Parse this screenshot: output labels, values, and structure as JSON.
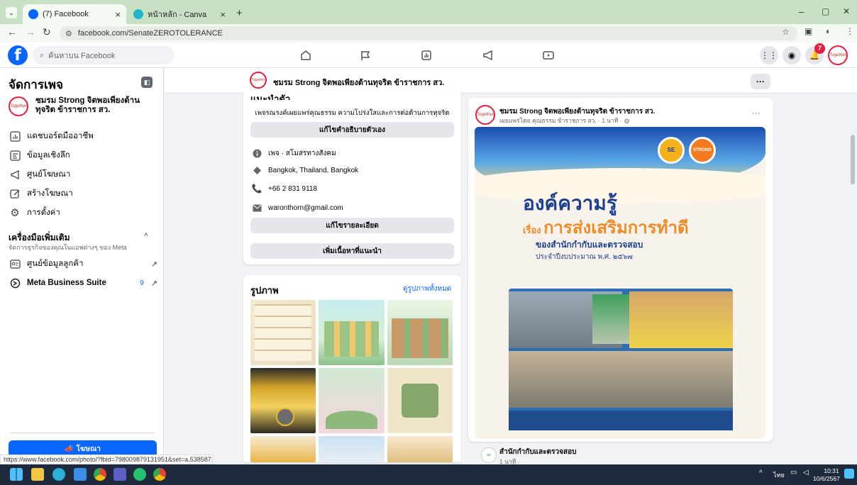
{
  "browser": {
    "tabs": [
      {
        "title": "(7) Facebook",
        "active": true
      },
      {
        "title": "หน้าหลัก - Canva",
        "active": false
      }
    ],
    "new_tab": "+",
    "url": "facebook.com/SenateZEROTOLERANCE",
    "window_controls": [
      "–",
      "▢",
      "✕"
    ]
  },
  "fb_nav": {
    "search_placeholder": "ค้นหาบน Facebook",
    "notif_count": "7"
  },
  "sidebar": {
    "title": "จัดการเพจ",
    "page_name": "ชมรม Strong จิตพอเพียงต้านทุจริต ข้าราชการ สว.",
    "items": [
      {
        "label": "แดชบอร์ดมืออาชีพ",
        "icon": "dashboard-icon"
      },
      {
        "label": "ข้อมูลเชิงลึก",
        "icon": "insights-icon"
      },
      {
        "label": "ศูนย์โฆษณา",
        "icon": "megaphone-icon"
      },
      {
        "label": "สร้างโฆษณา",
        "icon": "edit-icon"
      },
      {
        "label": "การตั้งค่า",
        "icon": "gear-icon"
      }
    ],
    "more_tools_title": "เครื่องมือเพิ่มเติม",
    "more_tools_sub": "จัดการธุรกิจของคุณในแอพต่างๆ ของ Meta",
    "tools": [
      {
        "label": "ศูนย์ข้อมูลลูกค้า",
        "badge": ""
      },
      {
        "label": "Meta Business Suite",
        "badge": "9"
      }
    ],
    "promote_button": "โฆษณา"
  },
  "page_header": {
    "name": "ชมรม Strong จิตพอเพียงต้านทุจริต ข้าราชการ สว.",
    "more": "···"
  },
  "intro": {
    "title": "แนะนำตัว",
    "bio": "เพจรณรงค์เผยแพร่คุณธรรม ความโปร่งใสและการต่อต้านการทุจริต",
    "edit_bio_button": "แก้ไขคำอธิบายตัวเอง",
    "details": [
      {
        "icon": "info-icon",
        "text": "เพจ · สโมสรทางสังคม"
      },
      {
        "icon": "location-icon",
        "text": "Bangkok, Thailand, Bangkok"
      },
      {
        "icon": "phone-icon",
        "text": "+66 2 831 9118"
      },
      {
        "icon": "mail-icon",
        "text": "waronthorn@gmail.com"
      }
    ],
    "edit_details_button": "แก้ไขรายละเอียด",
    "featured_button": "เพิ่มเนื้อหาที่แนะนำ"
  },
  "photos": {
    "title": "รูปภาพ",
    "see_all": "ดูรูปภาพทั้งหมด"
  },
  "post": {
    "author": "ชมรม Strong จิตพอเพียงต้านทุจริต ข้าราชการ สว.",
    "meta": "เผยแพร่โดย คุณธรรม ข้าราชการ สว. · 1 นาที ·",
    "more": "···",
    "image_title": "องค์ความรู้",
    "image_sub_prefix": "เรื่อง",
    "image_sub_highlight": "การส่งเสริมการทำดี",
    "image_line1": "ของสำนักกำกับและตรวจสอบ",
    "image_line2": "ประจำปีงบประมาณ พ.ศ. ๒๕๖๗",
    "logo_text": "STRONG"
  },
  "next_post": {
    "author": "สำนักกำกับและตรวจสอบ",
    "meta": "1 นาที ·"
  },
  "status_url": "https://www.facebook.com/photo/?fbid=798009879131951&set=a.538587188407556&__cft__[0]=AZXVVEpKBNeAW...",
  "taskbar": {
    "lang": "ไทย",
    "time": "10:31",
    "date": "10/6/2567"
  },
  "colors": {
    "fb_blue": "#0866ff",
    "tabstrip": "#c8e1c4",
    "accent_orange": "#f08a24",
    "post_blue": "#1d3f8f"
  }
}
